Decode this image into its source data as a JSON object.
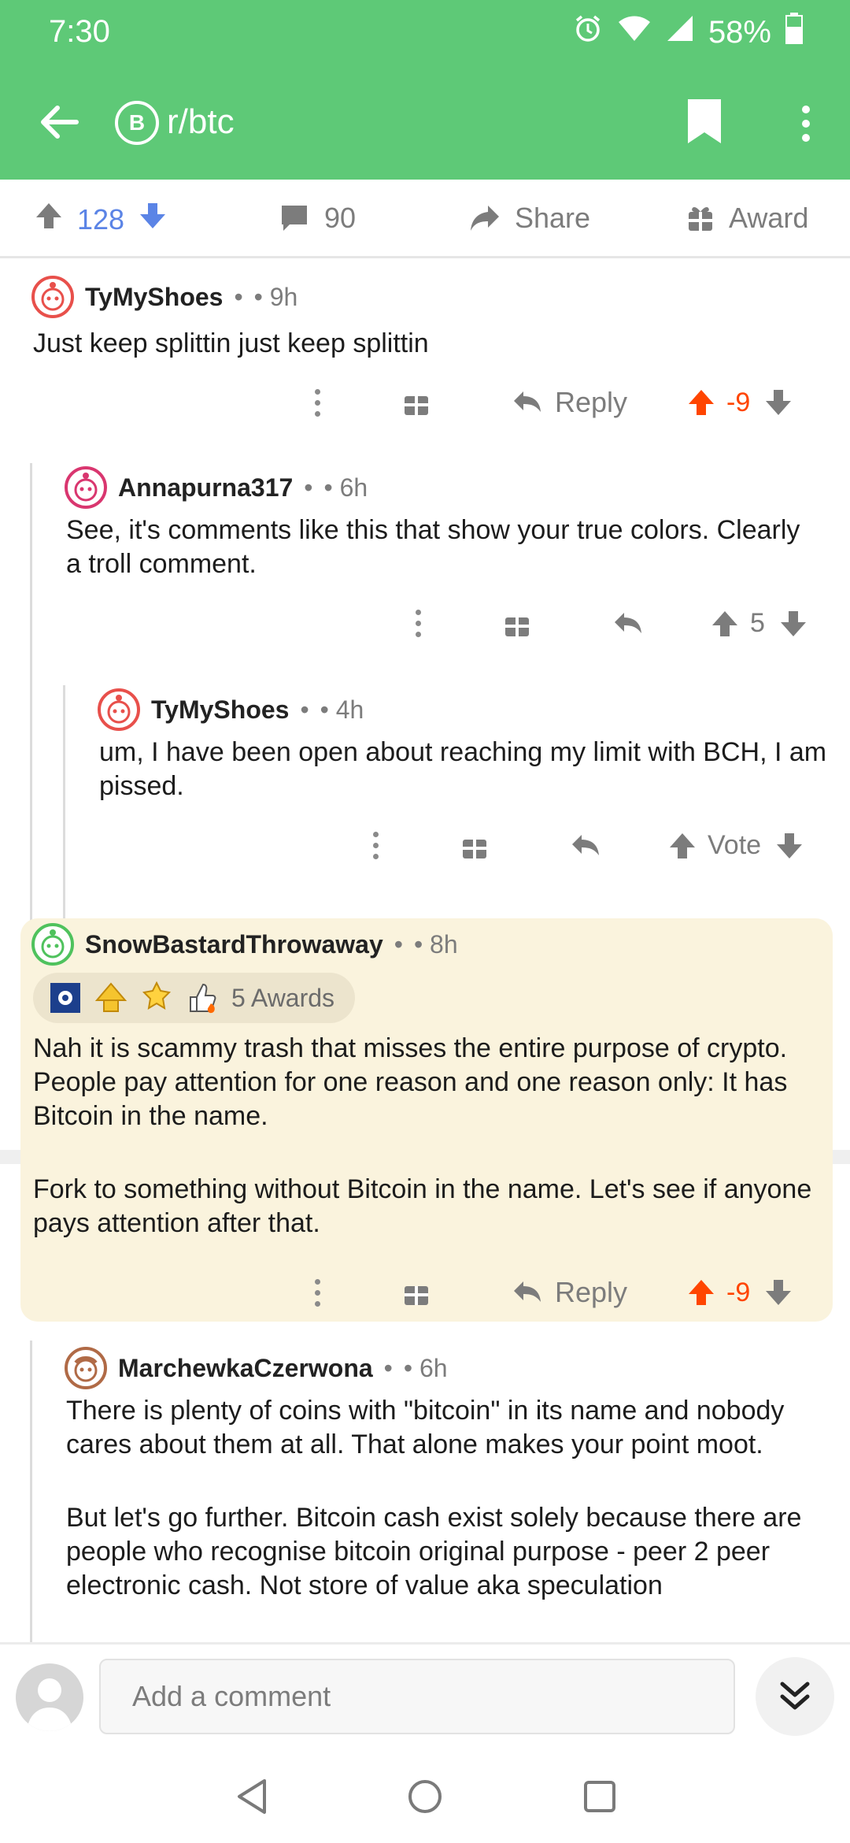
{
  "status_bar": {
    "time": "7:30",
    "battery": "58%"
  },
  "app_bar": {
    "subreddit": "r/btc",
    "subreddit_icon_letter": "B"
  },
  "post_actions": {
    "upvotes": "128",
    "comments": "90",
    "share": "Share",
    "award": "Award"
  },
  "comments": [
    {
      "author": "TyMyShoes",
      "age": "• 9h",
      "dot": "•",
      "body": "Just keep splittin just keep splittin",
      "reply_label": "Reply",
      "score": "-9",
      "voted": "up"
    },
    {
      "author": "Annapurna317",
      "age": "• 6h",
      "dot": "•",
      "body": "See, it's comments like this that show your true colors. Clearly a troll comment.",
      "score": "5"
    },
    {
      "author": "TyMyShoes",
      "age": "• 4h",
      "dot": "•",
      "body": "um, I have been open about reaching my limit with BCH, I am pissed.",
      "vote_label": "Vote"
    },
    {
      "author": "SnowBastardThrowaway",
      "age": "• 8h",
      "dot": "•",
      "awards_label": "5 Awards",
      "body_paragraphs": [
        "Nah it is scammy trash that misses the entire purpose of crypto. People pay attention for one reason and one reason only: It has Bitcoin in the name.",
        "Fork to something without Bitcoin in the name. Let's see if anyone pays attention after that."
      ],
      "reply_label": "Reply",
      "score": "-9",
      "voted": "up"
    },
    {
      "author": "MarchewkaCzerwona",
      "age": "• 6h",
      "dot": "•",
      "body_paragraphs": [
        "There is plenty of coins with \"bitcoin\" in its name and nobody cares about them at all. That alone makes your point moot.",
        "But let's go further. Bitcoin cash exist solely because there are people who recognise bitcoin original purpose - peer 2 peer electronic cash. Not store of value aka speculation"
      ]
    }
  ],
  "comment_bar": {
    "placeholder": "Add a comment"
  },
  "colors": {
    "brand": "#5ec977",
    "upvote": "#ff4500",
    "voted_blue": "#5b84e6",
    "highlight": "#faf3dd"
  }
}
